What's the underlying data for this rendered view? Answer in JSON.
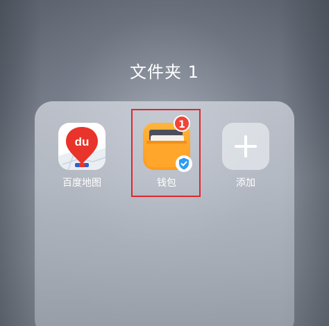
{
  "folder": {
    "title": "文件夹 1"
  },
  "apps": [
    {
      "label": "百度地图",
      "icon": "baidu-map-icon",
      "logo_text": "du"
    },
    {
      "label": "钱包",
      "icon": "wallet-icon",
      "badge": "1",
      "verified_icon": "shield-check-icon"
    },
    {
      "label": "添加",
      "icon": "plus-icon"
    }
  ],
  "colors": {
    "baidu_red": "#e8342a",
    "wallet_orange": "#ff9f22",
    "badge_red": "#f04438",
    "shield_blue": "#2d9cf0",
    "highlight_red": "#e0262b"
  }
}
